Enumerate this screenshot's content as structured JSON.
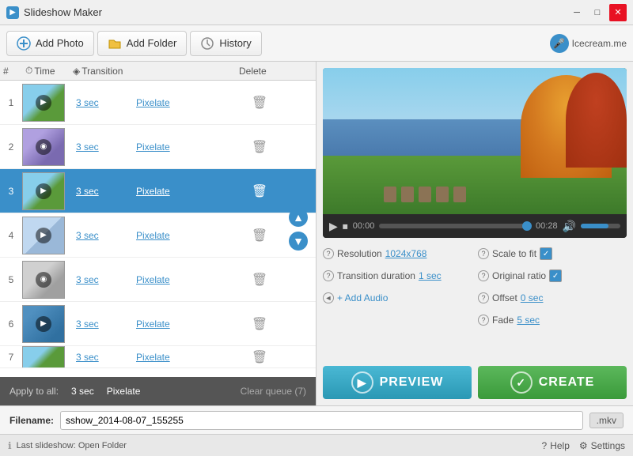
{
  "titlebar": {
    "title": "Slideshow Maker",
    "min_label": "─",
    "max_label": "□",
    "close_label": "✕"
  },
  "toolbar": {
    "add_photo_label": "Add Photo",
    "add_folder_label": "Add Folder",
    "history_label": "History",
    "brand_label": "Icecream.me"
  },
  "table": {
    "columns": [
      "#",
      "Time",
      "Transition",
      "",
      "Delete"
    ],
    "rows": [
      {
        "num": "1",
        "time": "3 sec",
        "transition": "Pixelate",
        "thumb_class": "thumb-1"
      },
      {
        "num": "2",
        "time": "3 sec",
        "transition": "Pixelate",
        "thumb_class": "thumb-2"
      },
      {
        "num": "3",
        "time": "3 sec",
        "transition": "Pixelate",
        "thumb_class": "thumb-3",
        "selected": true
      },
      {
        "num": "4",
        "time": "3 sec",
        "transition": "Pixelate",
        "thumb_class": "thumb-4"
      },
      {
        "num": "5",
        "time": "3 sec",
        "transition": "Pixelate",
        "thumb_class": "thumb-5"
      },
      {
        "num": "6",
        "time": "3 sec",
        "transition": "Pixelate",
        "thumb_class": "thumb-6"
      }
    ]
  },
  "apply_bar": {
    "label": "Apply to all:",
    "time": "3 sec",
    "transition": "Pixelate",
    "clear_queue": "Clear queue (7)"
  },
  "settings": {
    "resolution_label": "Resolution",
    "resolution_value": "1024x768",
    "transition_duration_label": "Transition duration",
    "transition_duration_value": "1 sec",
    "add_audio_label": "+ Add Audio",
    "scale_to_fit_label": "Scale to fit",
    "original_ratio_label": "Original ratio",
    "offset_label": "Offset",
    "offset_value": "0 sec",
    "fade_label": "Fade",
    "fade_value": "5 sec"
  },
  "video_controls": {
    "time_current": "00:00",
    "time_total": "00:28"
  },
  "filename": {
    "label": "Filename:",
    "value": "sshow_2014-08-07_155255",
    "extension": ".mkv"
  },
  "action_buttons": {
    "preview_label": "PREVIEW",
    "create_label": "CREATE"
  },
  "statusbar": {
    "last_slideshow_label": "Last slideshow: Open Folder",
    "help_label": "Help",
    "settings_label": "Settings"
  }
}
